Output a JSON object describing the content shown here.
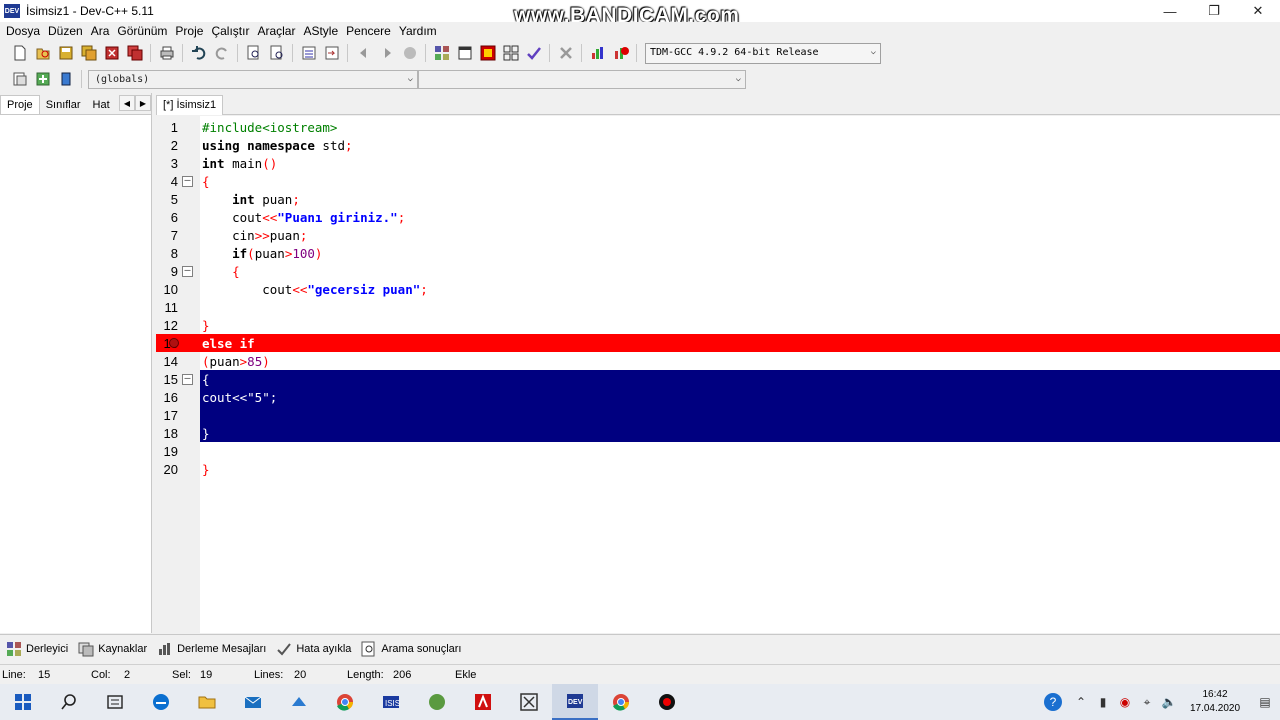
{
  "window": {
    "title": "İsimsiz1 - Dev-C++ 5.11",
    "icon_label": "DEV",
    "watermark": "www.BANDICAM.com"
  },
  "menu": [
    "Dosya",
    "Düzen",
    "Ara",
    "Görünüm",
    "Proje",
    "Çalıştır",
    "Araçlar",
    "AStyle",
    "Pencere",
    "Yardım"
  ],
  "toolbar": {
    "compiler": "TDM-GCC 4.9.2 64-bit Release",
    "scope": "(globals)",
    "member": ""
  },
  "left_panel": {
    "tabs": [
      "Proje",
      "Sınıflar",
      "Hat"
    ]
  },
  "editor": {
    "tab": "[*] İsimsiz1"
  },
  "bottom_tabs": [
    "Derleyici",
    "Kaynaklar",
    "Derleme Mesajları",
    "Hata ayıkla",
    "Arama sonuçları"
  ],
  "status": {
    "line_label": "Line:",
    "line": "15",
    "col_label": "Col:",
    "col": "2",
    "sel_label": "Sel:",
    "sel": "19",
    "lines_label": "Lines:",
    "lines": "20",
    "length_label": "Length:",
    "length": "206",
    "mode": "Ekle"
  },
  "taskbar": {
    "time": "16:42",
    "date": "17.04.2020"
  },
  "colors": {
    "breakpoint_line": "#ff0000",
    "selection": "#000080",
    "keyword_string": "#0000ff",
    "preprocessor": "#008000"
  }
}
